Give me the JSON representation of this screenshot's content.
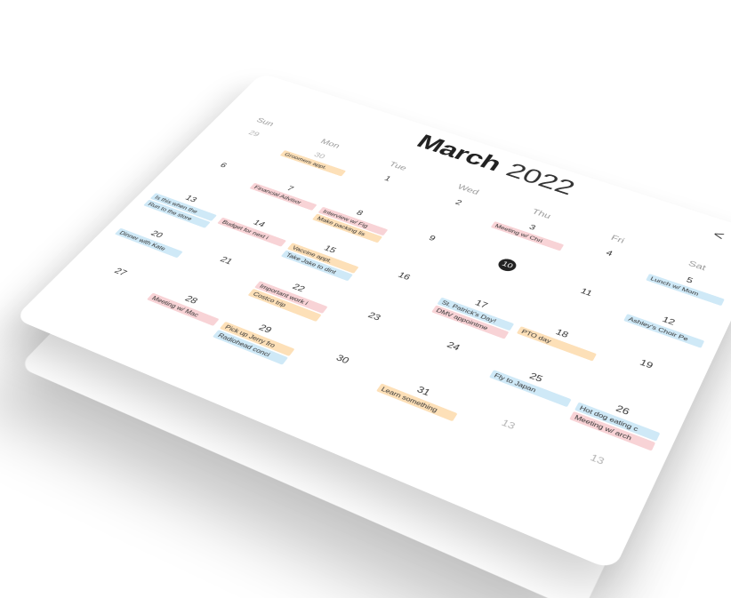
{
  "calendar": {
    "month": "March",
    "year": "2022",
    "nav": {
      "prev": "<",
      "next": ">"
    },
    "weekdays": [
      "Sun",
      "Mon",
      "Tue",
      "Wed",
      "Thu",
      "Fri",
      "Sat"
    ],
    "days": [
      {
        "num": "29",
        "muted": true,
        "events": []
      },
      {
        "num": "30",
        "muted": true,
        "events": [
          {
            "label": "Groomers appt.",
            "color": "orange"
          }
        ]
      },
      {
        "num": "1",
        "events": []
      },
      {
        "num": "2",
        "events": []
      },
      {
        "num": "3",
        "events": [
          {
            "label": "Meeting w/ Chri",
            "color": "pink"
          }
        ]
      },
      {
        "num": "4",
        "events": []
      },
      {
        "num": "5",
        "events": [
          {
            "label": "Lunch w/ Mom",
            "color": "blue"
          }
        ]
      },
      {
        "num": "6",
        "events": []
      },
      {
        "num": "7",
        "events": [
          {
            "label": "Financial Advisor",
            "color": "pink"
          }
        ]
      },
      {
        "num": "8",
        "events": [
          {
            "label": "Interview w/ Fig",
            "color": "pink"
          },
          {
            "label": "Make packing lis",
            "color": "orange"
          }
        ]
      },
      {
        "num": "9",
        "events": []
      },
      {
        "num": "10",
        "today": true,
        "events": []
      },
      {
        "num": "11",
        "events": []
      },
      {
        "num": "12",
        "events": [
          {
            "label": "Ashley's Choir Pe",
            "color": "blue"
          }
        ]
      },
      {
        "num": "13",
        "events": [
          {
            "label": "Is this when the",
            "color": "blue"
          },
          {
            "label": "Run to the store",
            "color": "blue"
          }
        ]
      },
      {
        "num": "14",
        "events": [
          {
            "label": "Budget for next i",
            "color": "pink"
          }
        ]
      },
      {
        "num": "15",
        "events": [
          {
            "label": "Vaccine appt.",
            "color": "orange"
          },
          {
            "label": "Take Jake to dint",
            "color": "blue"
          }
        ]
      },
      {
        "num": "16",
        "events": []
      },
      {
        "num": "17",
        "events": [
          {
            "label": "St. Patrick's Day!",
            "color": "blue"
          },
          {
            "label": "DMV appointme",
            "color": "pink"
          }
        ]
      },
      {
        "num": "18",
        "events": [
          {
            "label": "PTO day",
            "color": "orange"
          }
        ]
      },
      {
        "num": "19",
        "events": []
      },
      {
        "num": "20",
        "events": [
          {
            "label": "Dinner with Kate",
            "color": "blue"
          }
        ]
      },
      {
        "num": "21",
        "events": []
      },
      {
        "num": "22",
        "events": [
          {
            "label": "Important work i",
            "color": "pink"
          },
          {
            "label": "Costco trip",
            "color": "orange"
          }
        ]
      },
      {
        "num": "23",
        "events": []
      },
      {
        "num": "24",
        "events": []
      },
      {
        "num": "25",
        "events": [
          {
            "label": "Fly to Japan",
            "color": "blue"
          }
        ]
      },
      {
        "num": "26",
        "events": [
          {
            "label": "Hot dog eating c",
            "color": "blue"
          },
          {
            "label": "Meeting w/ arch",
            "color": "pink"
          }
        ]
      },
      {
        "num": "27",
        "events": []
      },
      {
        "num": "28",
        "events": [
          {
            "label": "Meeting w/ Mac",
            "color": "pink"
          }
        ]
      },
      {
        "num": "29",
        "events": [
          {
            "label": "Pick up Jerry fro",
            "color": "orange"
          },
          {
            "label": "Radiohead conci",
            "color": "blue"
          }
        ]
      },
      {
        "num": "30",
        "events": []
      },
      {
        "num": "31",
        "events": [
          {
            "label": "Learn something",
            "color": "orange"
          }
        ]
      },
      {
        "num": "13",
        "muted": true,
        "events": []
      },
      {
        "num": "13",
        "muted": true,
        "events": []
      }
    ]
  }
}
